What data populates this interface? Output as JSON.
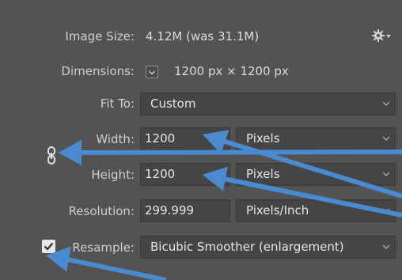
{
  "image_size": {
    "label": "Image Size:",
    "value": "4.12M (was 31.1M)"
  },
  "settings_icon": "gear-icon",
  "dimensions": {
    "label": "Dimensions:",
    "value": "1200 px  ×  1200 px"
  },
  "fit_to": {
    "label": "Fit To:",
    "value": "Custom"
  },
  "width": {
    "label": "Width:",
    "value": "1200",
    "unit": "Pixels"
  },
  "height": {
    "label": "Height:",
    "value": "1200",
    "unit": "Pixels"
  },
  "resolution": {
    "label": "Resolution:",
    "value": "299.999",
    "unit": "Pixels/Inch"
  },
  "resample": {
    "label": "Resample:",
    "checked": true,
    "value": "Bicubic Smoother (enlargement)"
  },
  "link_icon": "chain-link-icon",
  "colors": {
    "background": "#535353",
    "field": "#454545",
    "arrow": "#4a8ad0"
  }
}
